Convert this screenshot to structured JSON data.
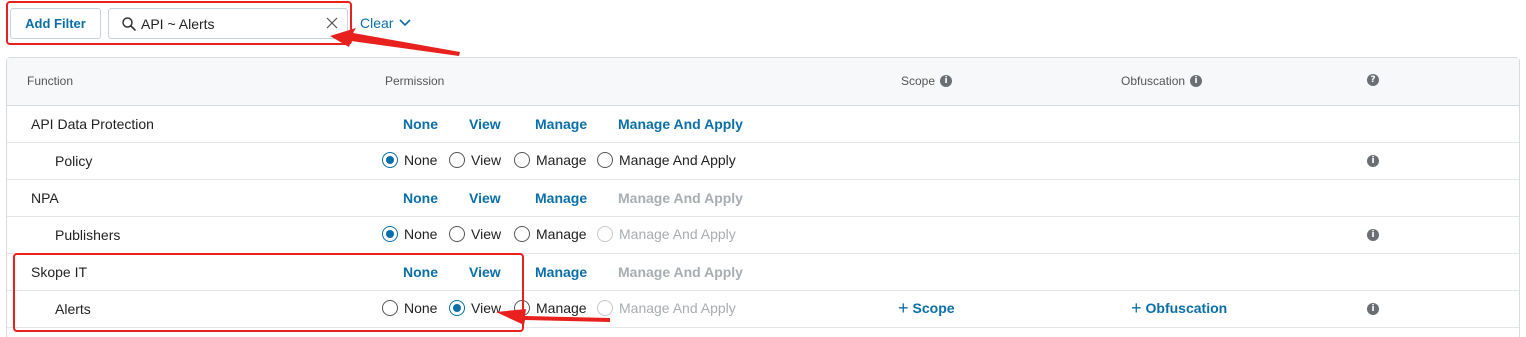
{
  "toolbar": {
    "add_filter_label": "Add Filter",
    "search_value": "API ~ Alerts",
    "clear_label": "Clear"
  },
  "table": {
    "headers": {
      "function": "Function",
      "permission": "Permission",
      "scope": "Scope",
      "obfuscation": "Obfuscation"
    },
    "rows": [
      {
        "name": "API Data Protection",
        "type": "group",
        "options": [
          {
            "label": "None",
            "disabled": false
          },
          {
            "label": "View",
            "disabled": false
          },
          {
            "label": "Manage",
            "disabled": false
          },
          {
            "label": "Manage And Apply",
            "disabled": false
          }
        ]
      },
      {
        "name": "Policy",
        "type": "child",
        "selected": "None",
        "options": [
          {
            "label": "None",
            "disabled": false
          },
          {
            "label": "View",
            "disabled": false
          },
          {
            "label": "Manage",
            "disabled": false
          },
          {
            "label": "Manage And Apply",
            "disabled": false
          }
        ]
      },
      {
        "name": "NPA",
        "type": "group",
        "options": [
          {
            "label": "None",
            "disabled": false
          },
          {
            "label": "View",
            "disabled": false
          },
          {
            "label": "Manage",
            "disabled": false
          },
          {
            "label": "Manage And Apply",
            "disabled": true
          }
        ]
      },
      {
        "name": "Publishers",
        "type": "child",
        "selected": "None",
        "options": [
          {
            "label": "None",
            "disabled": false
          },
          {
            "label": "View",
            "disabled": false
          },
          {
            "label": "Manage",
            "disabled": false
          },
          {
            "label": "Manage And Apply",
            "disabled": true
          }
        ]
      },
      {
        "name": "Skope IT",
        "type": "group",
        "options": [
          {
            "label": "None",
            "disabled": false
          },
          {
            "label": "View",
            "disabled": false
          },
          {
            "label": "Manage",
            "disabled": false
          },
          {
            "label": "Manage And Apply",
            "disabled": true
          }
        ]
      },
      {
        "name": "Alerts",
        "type": "child",
        "selected": "View",
        "options": [
          {
            "label": "None",
            "disabled": false
          },
          {
            "label": "View",
            "disabled": false
          },
          {
            "label": "Manage",
            "disabled": false
          },
          {
            "label": "Manage And Apply",
            "disabled": true
          }
        ],
        "scope_link": "Scope",
        "obfuscation_link": "Obfuscation"
      }
    ]
  },
  "colors": {
    "accent": "#0a6fa8",
    "annotation": "#e8201e",
    "disabled": "#a8adb2"
  }
}
